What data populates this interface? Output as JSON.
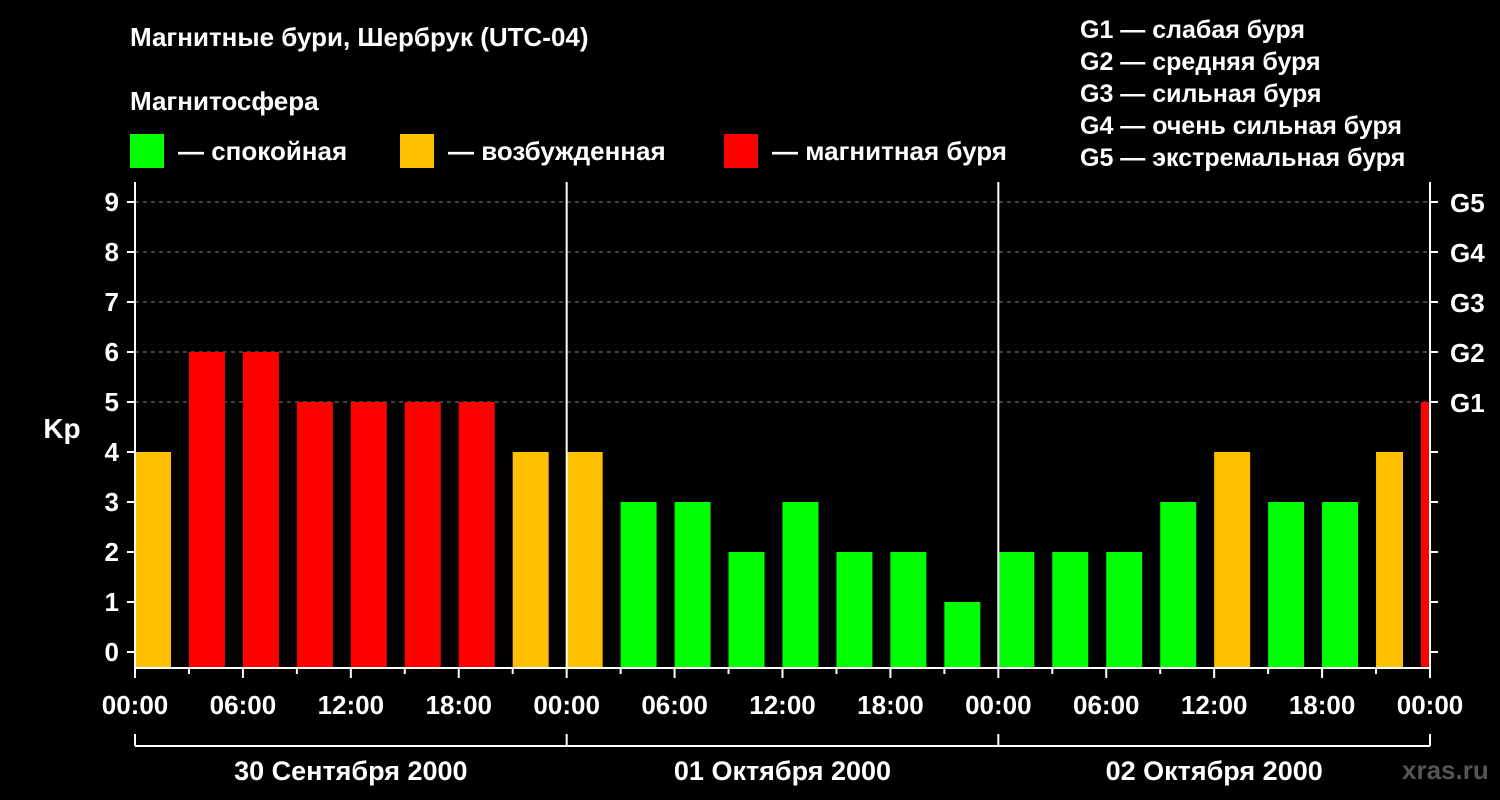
{
  "title": "Магнитные бури, Шербрук (UTC-04)",
  "subtitle": "Магнитосфера",
  "legend": [
    {
      "label": "— спокойная",
      "color": "#00ff00"
    },
    {
      "label": "— возбужденная",
      "color": "#ffc000"
    },
    {
      "label": "— магнитная буря",
      "color": "#ff0000"
    }
  ],
  "g_legend": [
    "G1 — слабая буря",
    "G2 — средняя буря",
    "G3 — сильная буря",
    "G4 — очень сильная буря",
    "G5 — экстремальная буря"
  ],
  "watermark": "xras.ru",
  "colors": {
    "quiet": "#00ff00",
    "active": "#ffc000",
    "storm": "#ff0000",
    "background": "#000000",
    "axis": "#ffffff",
    "grid": "#808080"
  },
  "chart_data": {
    "type": "bar",
    "ylabel": "Kp",
    "ylim": [
      0,
      9
    ],
    "y_ticks": [
      "0",
      "1",
      "2",
      "3",
      "4",
      "5",
      "6",
      "7",
      "8",
      "9"
    ],
    "g_ticks": [
      {
        "value": 5,
        "label": "G1"
      },
      {
        "value": 6,
        "label": "G2"
      },
      {
        "value": 7,
        "label": "G3"
      },
      {
        "value": 8,
        "label": "G4"
      },
      {
        "value": 9,
        "label": "G5"
      }
    ],
    "x_tick_labels": [
      "00:00",
      "06:00",
      "12:00",
      "18:00",
      "00:00",
      "06:00",
      "12:00",
      "18:00",
      "00:00",
      "06:00",
      "12:00",
      "18:00",
      "00:00"
    ],
    "days": [
      "30 Сентября 2000",
      "01 Октября 2000",
      "02 Октября 2000"
    ],
    "bar_hours": 3,
    "total_hours": 72,
    "grid": "dashed horizontal",
    "series": [
      {
        "start_hours": [
          0,
          3,
          6,
          9,
          12,
          15,
          18,
          21,
          24,
          27,
          30,
          33,
          36,
          39,
          42,
          45,
          48,
          51,
          54,
          57,
          60,
          63,
          66,
          69,
          71.5
        ],
        "end_hours": [
          2,
          5,
          8,
          11,
          14,
          17,
          20,
          23,
          26,
          29,
          32,
          35,
          38,
          41,
          44,
          47,
          50,
          53,
          56,
          59,
          62,
          65,
          68,
          70.5,
          72
        ],
        "values": [
          4,
          6,
          6,
          5,
          5,
          5,
          5,
          4,
          4,
          3,
          3,
          2,
          3,
          2,
          2,
          1,
          2,
          2,
          2,
          3,
          4,
          3,
          3,
          4,
          5
        ],
        "levels": [
          "active",
          "storm",
          "storm",
          "storm",
          "storm",
          "storm",
          "storm",
          "active",
          "active",
          "quiet",
          "quiet",
          "quiet",
          "quiet",
          "quiet",
          "quiet",
          "quiet",
          "quiet",
          "quiet",
          "quiet",
          "quiet",
          "active",
          "quiet",
          "quiet",
          "active",
          "storm"
        ]
      }
    ]
  }
}
